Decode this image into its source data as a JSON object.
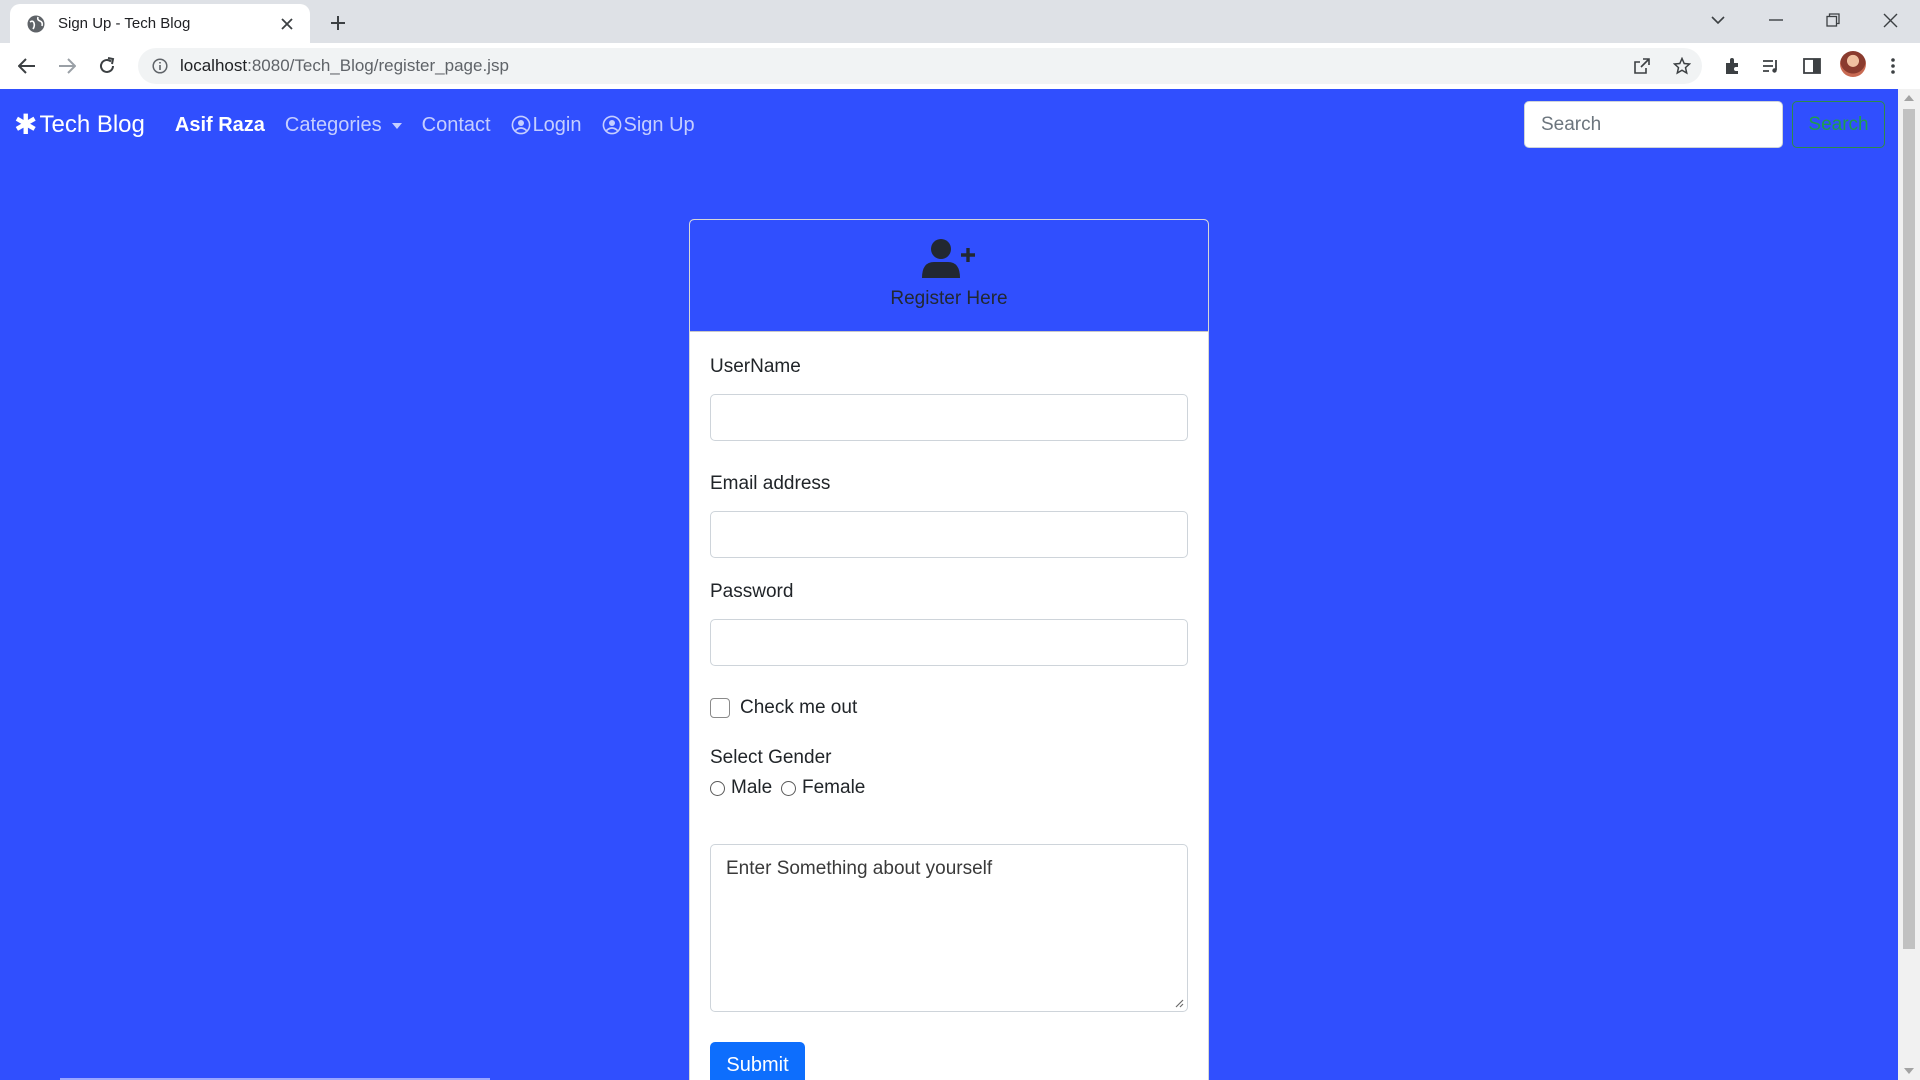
{
  "browser": {
    "tab_title": "Sign Up - Tech Blog",
    "url_host": "localhost",
    "url_rest": ":8080/Tech_Blog/register_page.jsp"
  },
  "navbar": {
    "brand": "Tech Blog",
    "brand_symbol": "✱",
    "links": [
      {
        "label": "Asif Raza"
      },
      {
        "label": "Categories"
      },
      {
        "label": "Contact"
      },
      {
        "label": "Login"
      },
      {
        "label": "Sign Up"
      }
    ],
    "search_placeholder": "Search",
    "search_button": "Search"
  },
  "form": {
    "header_title": "Register Here",
    "username_label": "UserName",
    "email_label": "Email address",
    "password_label": "Password",
    "check_label": "Check me out",
    "gender_label": "Select Gender",
    "gender_options": [
      "Male",
      "Female"
    ],
    "about_placeholder": "Enter Something about yourself",
    "submit_label": "Submit"
  },
  "colors": {
    "page_background": "#304ffe",
    "submit_button": "#0d6efd",
    "search_button_outline": "#2e8a4a"
  }
}
